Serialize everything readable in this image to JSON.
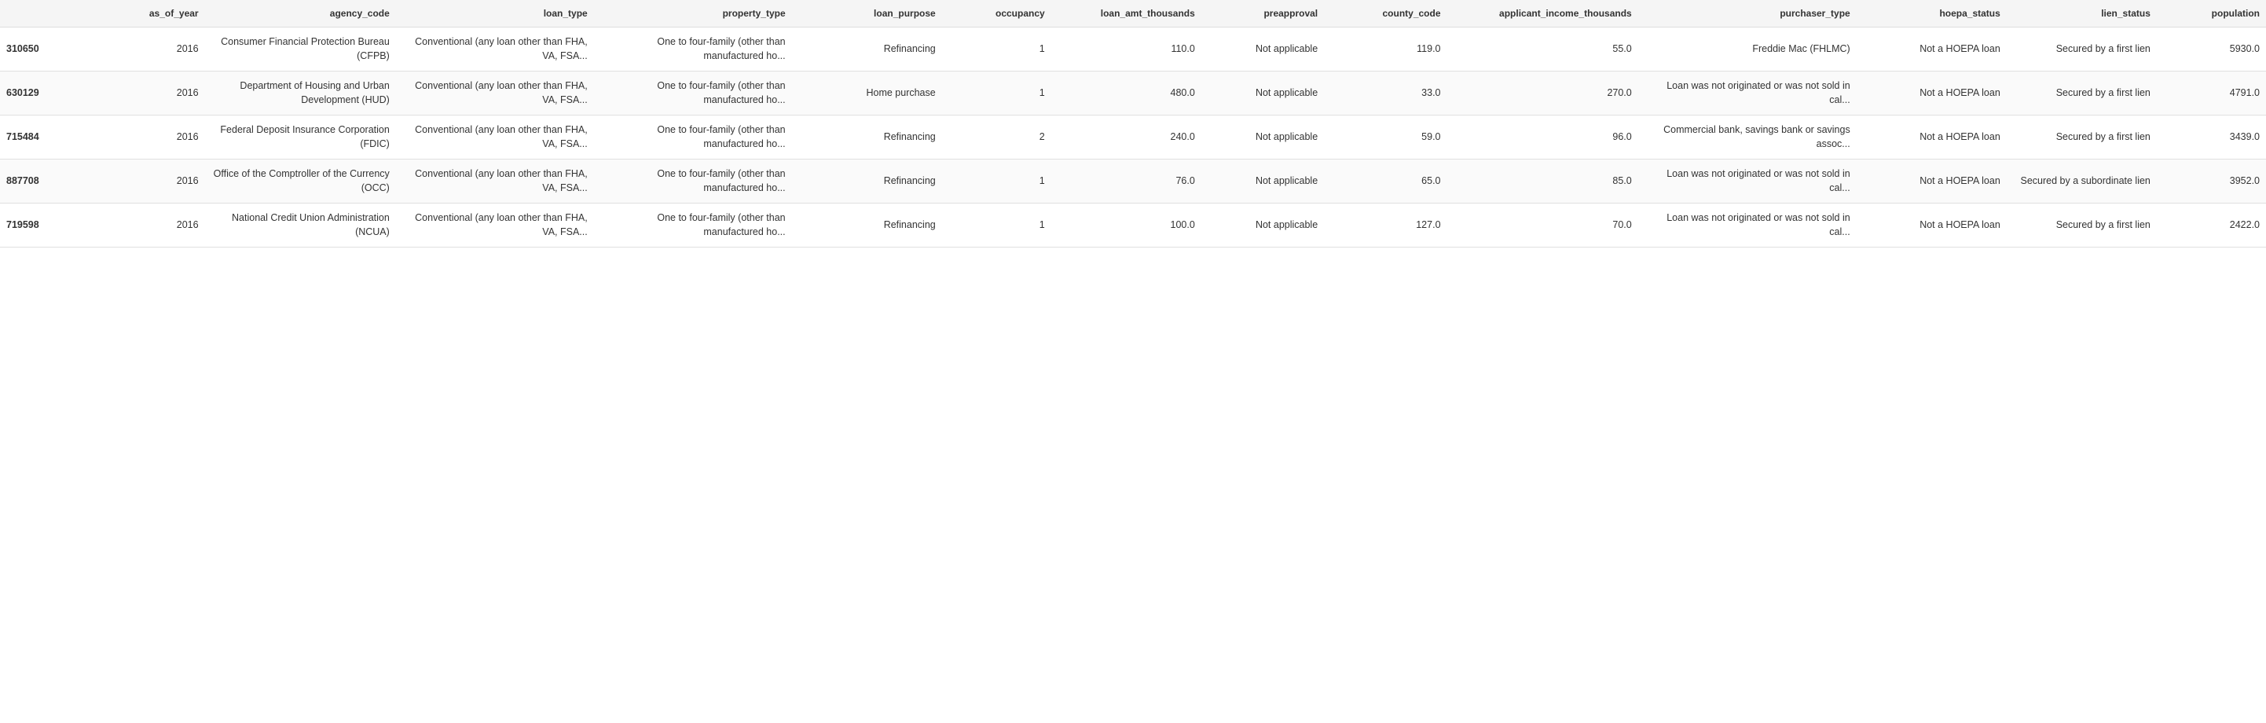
{
  "table": {
    "columns": [
      {
        "key": "id",
        "label": "",
        "align": "left"
      },
      {
        "key": "as_of_year",
        "label": "as_of_year",
        "align": "right"
      },
      {
        "key": "agency_code",
        "label": "agency_code",
        "align": "right"
      },
      {
        "key": "loan_type",
        "label": "loan_type",
        "align": "right"
      },
      {
        "key": "property_type",
        "label": "property_type",
        "align": "right"
      },
      {
        "key": "loan_purpose",
        "label": "loan_purpose",
        "align": "right"
      },
      {
        "key": "occupancy",
        "label": "occupancy",
        "align": "right"
      },
      {
        "key": "loan_amt_thousands",
        "label": "loan_amt_thousands",
        "align": "right"
      },
      {
        "key": "preapproval",
        "label": "preapproval",
        "align": "right"
      },
      {
        "key": "county_code",
        "label": "county_code",
        "align": "right"
      },
      {
        "key": "applicant_income_thousands",
        "label": "applicant_income_thousands",
        "align": "right"
      },
      {
        "key": "purchaser_type",
        "label": "purchaser_type",
        "align": "right"
      },
      {
        "key": "hoepa_status",
        "label": "hoepa_status",
        "align": "right"
      },
      {
        "key": "lien_status",
        "label": "lien_status",
        "align": "right"
      },
      {
        "key": "population",
        "label": "population",
        "align": "right"
      }
    ],
    "rows": [
      {
        "id": "310650",
        "as_of_year": "2016",
        "agency_code": "Consumer Financial Protection Bureau (CFPB)",
        "loan_type": "Conventional (any loan other than FHA, VA, FSA...",
        "property_type": "One to four-family (other than manufactured ho...",
        "loan_purpose": "Refinancing",
        "occupancy": "1",
        "loan_amt_thousands": "110.0",
        "preapproval": "Not applicable",
        "county_code": "119.0",
        "applicant_income_thousands": "55.0",
        "purchaser_type": "Freddie Mac (FHLMC)",
        "hoepa_status": "Not a HOEPA loan",
        "lien_status": "Secured by a first lien",
        "population": "5930.0"
      },
      {
        "id": "630129",
        "as_of_year": "2016",
        "agency_code": "Department of Housing and Urban Development (HUD)",
        "loan_type": "Conventional (any loan other than FHA, VA, FSA...",
        "property_type": "One to four-family (other than manufactured ho...",
        "loan_purpose": "Home purchase",
        "occupancy": "1",
        "loan_amt_thousands": "480.0",
        "preapproval": "Not applicable",
        "county_code": "33.0",
        "applicant_income_thousands": "270.0",
        "purchaser_type": "Loan was not originated or was not sold in cal...",
        "hoepa_status": "Not a HOEPA loan",
        "lien_status": "Secured by a first lien",
        "population": "4791.0"
      },
      {
        "id": "715484",
        "as_of_year": "2016",
        "agency_code": "Federal Deposit Insurance Corporation (FDIC)",
        "loan_type": "Conventional (any loan other than FHA, VA, FSA...",
        "property_type": "One to four-family (other than manufactured ho...",
        "loan_purpose": "Refinancing",
        "occupancy": "2",
        "loan_amt_thousands": "240.0",
        "preapproval": "Not applicable",
        "county_code": "59.0",
        "applicant_income_thousands": "96.0",
        "purchaser_type": "Commercial bank, savings bank or savings assoc...",
        "hoepa_status": "Not a HOEPA loan",
        "lien_status": "Secured by a first lien",
        "population": "3439.0"
      },
      {
        "id": "887708",
        "as_of_year": "2016",
        "agency_code": "Office of the Comptroller of the Currency (OCC)",
        "loan_type": "Conventional (any loan other than FHA, VA, FSA...",
        "property_type": "One to four-family (other than manufactured ho...",
        "loan_purpose": "Refinancing",
        "occupancy": "1",
        "loan_amt_thousands": "76.0",
        "preapproval": "Not applicable",
        "county_code": "65.0",
        "applicant_income_thousands": "85.0",
        "purchaser_type": "Loan was not originated or was not sold in cal...",
        "hoepa_status": "Not a HOEPA loan",
        "lien_status": "Secured by a subordinate lien",
        "population": "3952.0"
      },
      {
        "id": "719598",
        "as_of_year": "2016",
        "agency_code": "National Credit Union Administration (NCUA)",
        "loan_type": "Conventional (any loan other than FHA, VA, FSA...",
        "property_type": "One to four-family (other than manufactured ho...",
        "loan_purpose": "Refinancing",
        "occupancy": "1",
        "loan_amt_thousands": "100.0",
        "preapproval": "Not applicable",
        "county_code": "127.0",
        "applicant_income_thousands": "70.0",
        "purchaser_type": "Loan was not originated or was not sold in cal...",
        "hoepa_status": "Not a HOEPA loan",
        "lien_status": "Secured by a first lien",
        "population": "2422.0"
      }
    ]
  }
}
